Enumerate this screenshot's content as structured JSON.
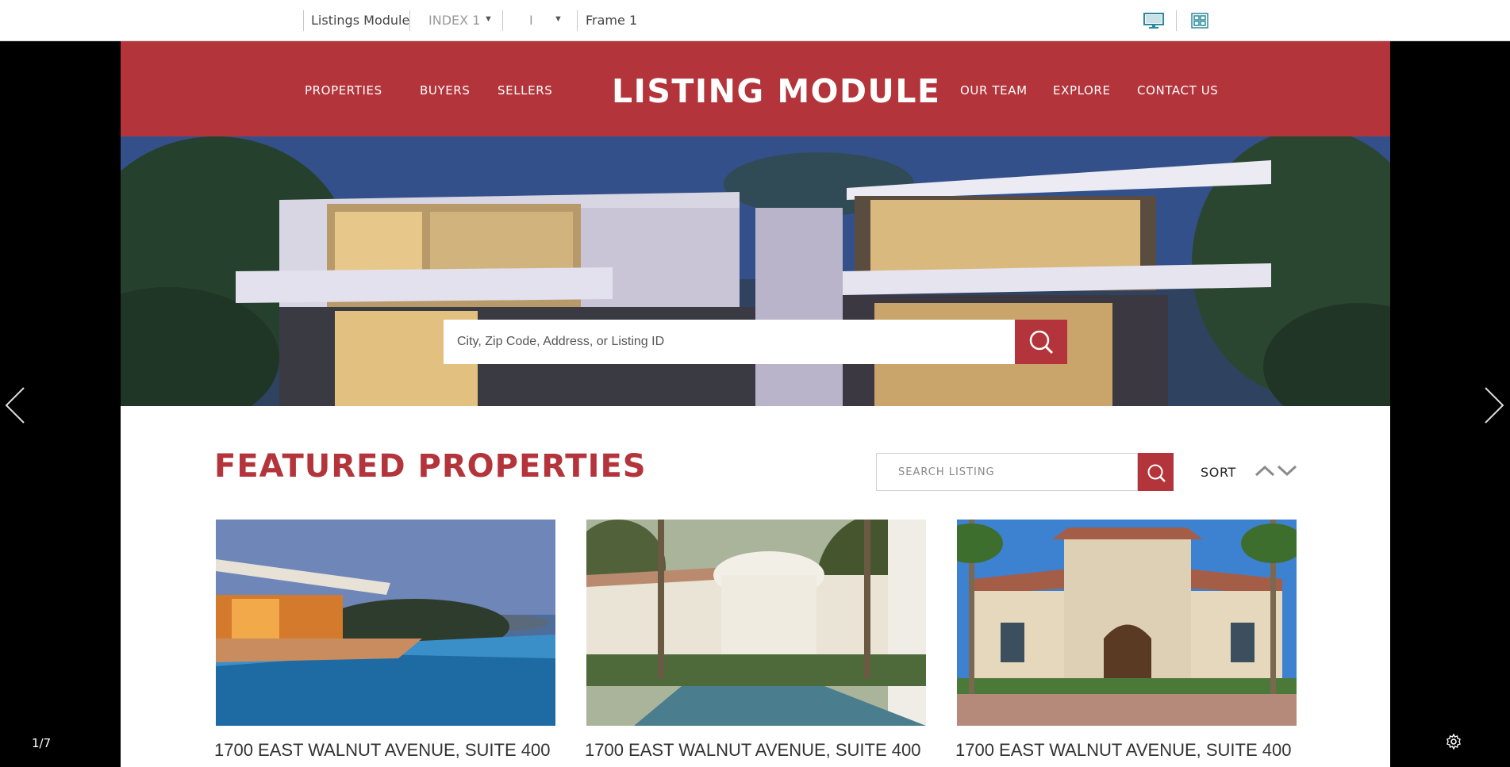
{
  "toolbar": {
    "module_name": "Listings Module",
    "index_select": "INDEX 1",
    "second_select": "I",
    "frame_label": "Frame 1",
    "desktop_icon": "desktop-icon",
    "grid_icon": "grid-view-icon"
  },
  "viewer": {
    "slide_counter": "1/7",
    "prev_icon": "chevron-left-icon",
    "next_icon": "chevron-right-icon",
    "settings_icon": "gear-icon"
  },
  "header": {
    "logo": "LISTING MODULE",
    "nav_left": [
      "PROPERTIES",
      "BUYERS",
      "SELLERS"
    ],
    "nav_right": [
      "OUR TEAM",
      "EXPLORE",
      "CONTACT US"
    ],
    "background_color": "#b3343a"
  },
  "hero": {
    "search_placeholder": "City, Zip Code, Address, or Listing ID",
    "search_icon": "search-icon"
  },
  "featured": {
    "title": "FEATURED PROPERTIES",
    "search_placeholder": "SEARCH LISTING",
    "sort_label": "SORT",
    "sort_icons": [
      "chevron-up-icon",
      "chevron-down-icon"
    ]
  },
  "listings": [
    {
      "address": "1700 EAST WALNUT AVENUE, SUITE 400",
      "image": "pool-pavilion-at-dusk"
    },
    {
      "address": "1700 EAST WALNUT AVENUE, SUITE 400",
      "image": "white-villa-with-pool"
    },
    {
      "address": "1700 EAST WALNUT AVENUE, SUITE 400",
      "image": "mediterranean-house-with-palms"
    }
  ]
}
